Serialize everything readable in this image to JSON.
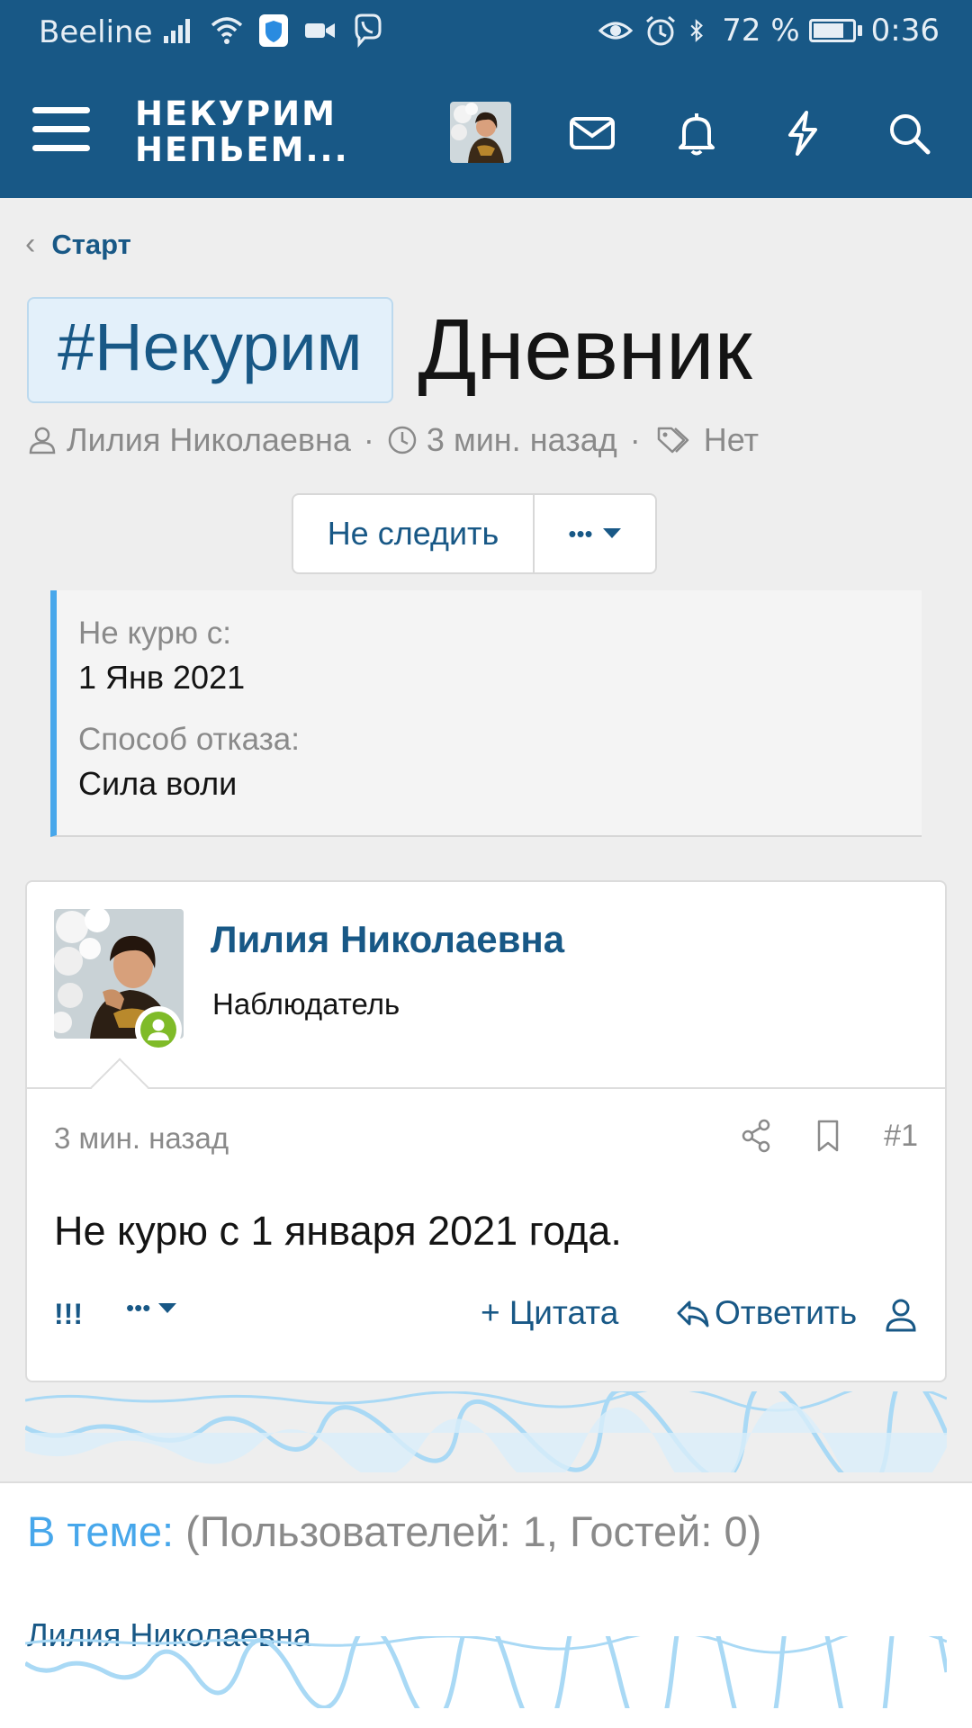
{
  "statusbar": {
    "carrier": "Beeline",
    "battery": "72 %",
    "battery_level": 0.72,
    "time": "0:36"
  },
  "header": {
    "logo_line1": "НЕКУРИМ",
    "logo_line2": "НЕПЬЕМ..."
  },
  "breadcrumb": {
    "label": "Старт"
  },
  "thread": {
    "prefix": "#Некурим",
    "title": "Дневник",
    "author": "Лилия Николаевна",
    "time": "3 мин. назад",
    "tags": "Нет",
    "meta_sep": "·"
  },
  "buttons": {
    "watch": "Не следить",
    "more": "•••"
  },
  "fields": [
    {
      "label": "Не курю с:",
      "value": "1 Янв 2021"
    },
    {
      "label": "Способ отказа:",
      "value": "Сила воли"
    }
  ],
  "post": {
    "username": "Лилия Николаевна",
    "role": "Наблюдатель",
    "time": "3 мин. назад",
    "number": "#1",
    "body": "Не курю с 1 января 2021 года.",
    "react": "!!!",
    "more": "•••",
    "quote": "+ Цитата",
    "reply": "Ответить"
  },
  "users_in_thread": {
    "label": "В теме:",
    "counts": "(Пользователей: 1, Гостей: 0)",
    "user": "Лилия Николаевна"
  },
  "colors": {
    "brand": "#185886",
    "accent": "#47a7eb",
    "online": "#7fbb28"
  }
}
